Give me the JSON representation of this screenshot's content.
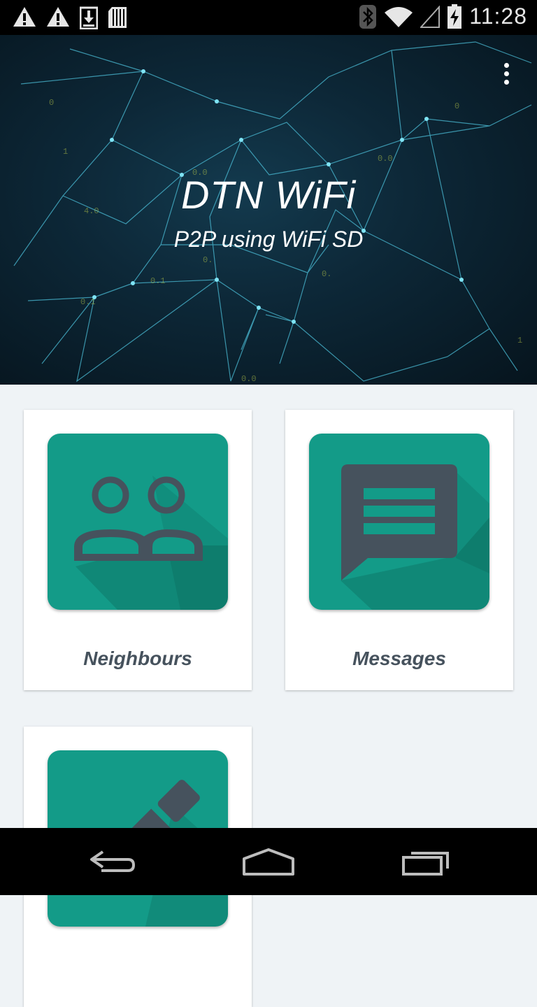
{
  "status_bar": {
    "time": "11:28",
    "left_icons": [
      "warning-icon",
      "warning-icon",
      "download-icon",
      "storage-icon"
    ],
    "right_icons": [
      "bluetooth-icon",
      "wifi-icon",
      "cell-signal-icon",
      "battery-charging-icon"
    ]
  },
  "header": {
    "title": "DTN WiFi",
    "subtitle": "P2P using WiFi SD",
    "menu_icon": "overflow-menu-icon"
  },
  "cards": [
    {
      "label": "Neighbours",
      "icon": "people-icon"
    },
    {
      "label": "Messages",
      "icon": "message-icon"
    },
    {
      "label": "",
      "icon": "edit-icon"
    }
  ],
  "colors": {
    "tile": "#139b88",
    "icon": "#46525d",
    "background": "#eff3f6"
  },
  "nav_bar": {
    "buttons": [
      "back-icon",
      "home-icon",
      "recents-icon"
    ]
  }
}
